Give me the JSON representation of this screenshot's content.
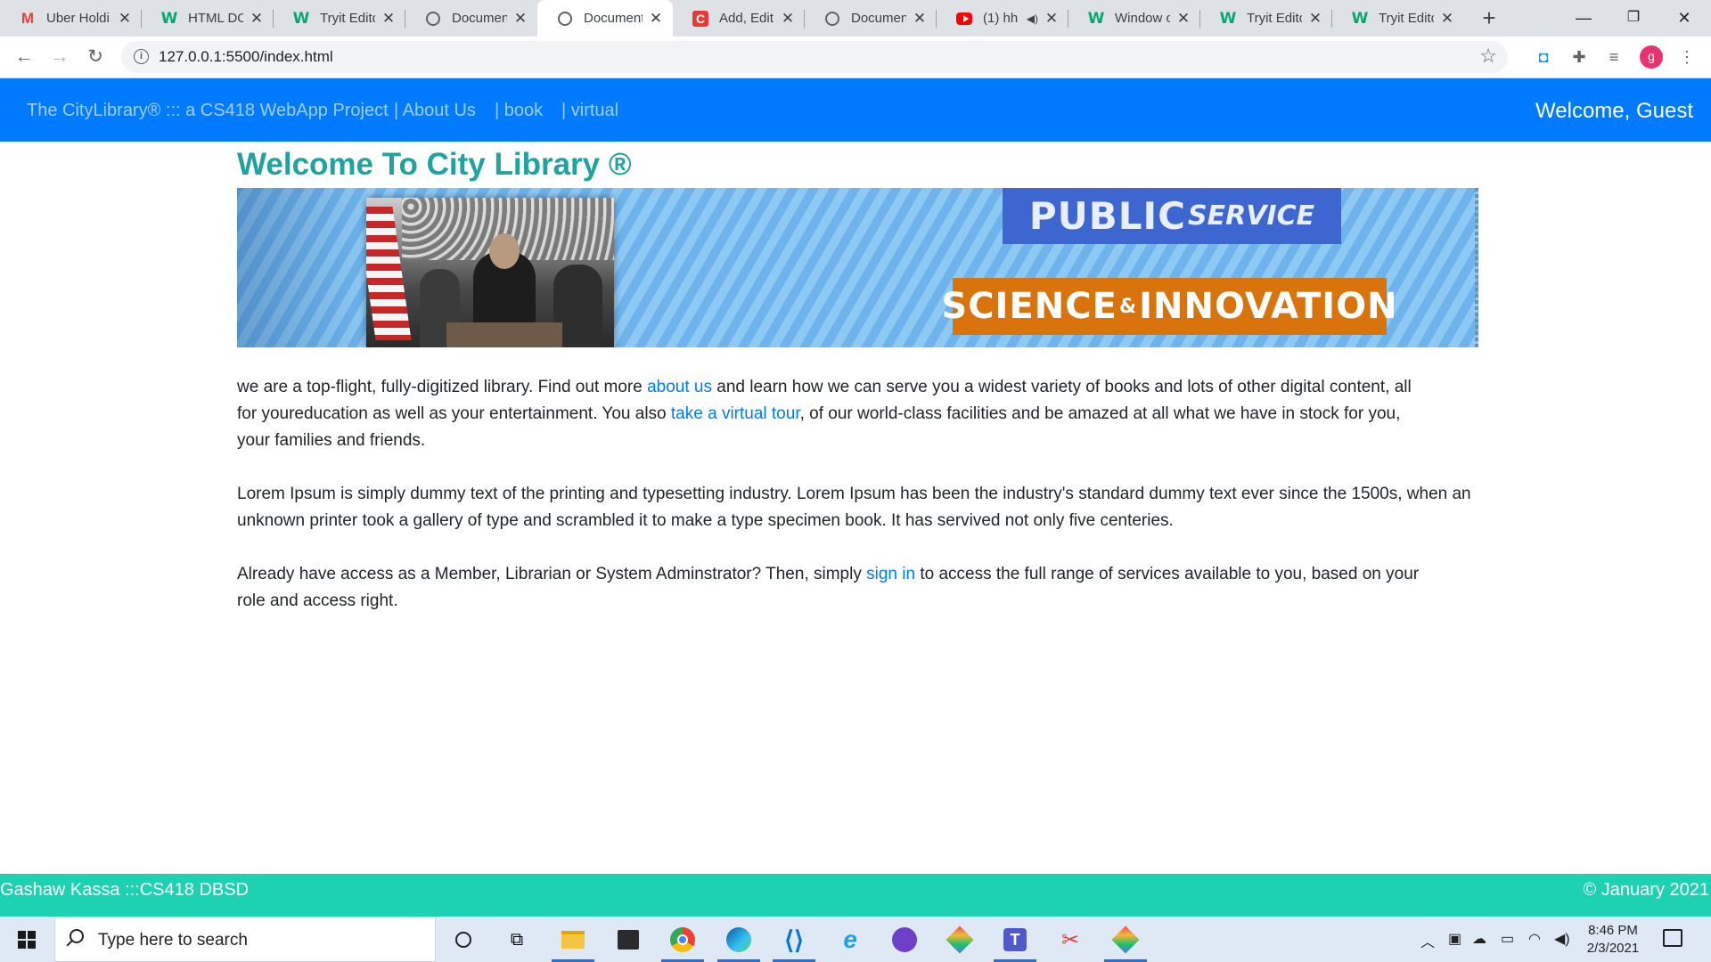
{
  "browser": {
    "tabs": [
      {
        "title": "Uber Holdi",
        "favicon": "gmail-icon",
        "active": false
      },
      {
        "title": "HTML DOI",
        "favicon": "w3schools-icon",
        "active": false
      },
      {
        "title": "Tryit Edito",
        "favicon": "w3schools-icon",
        "active": false
      },
      {
        "title": "Document",
        "favicon": "globe-icon",
        "active": false
      },
      {
        "title": "Document",
        "favicon": "globe-icon",
        "active": true
      },
      {
        "title": "Add, Edit c",
        "favicon": "c-app-icon",
        "active": false
      },
      {
        "title": "Document",
        "favicon": "globe-icon",
        "active": false
      },
      {
        "title": "(1) hh",
        "favicon": "youtube-icon",
        "active": false
      },
      {
        "title": "Window c",
        "favicon": "w3schools-icon",
        "active": false
      },
      {
        "title": "Tryit Edito",
        "favicon": "w3schools-icon",
        "active": false
      },
      {
        "title": "Tryit Edito",
        "favicon": "w3schools-icon",
        "active": false
      }
    ],
    "url": "127.0.0.1:5500/index.html",
    "profile_initial": "g"
  },
  "navbar": {
    "brand": "The CityLibrary® ::: a CS418 WebApp Project",
    "links": [
      "| About Us",
      "| book",
      "| virtual"
    ],
    "welcome": "Welcome, Guest"
  },
  "main": {
    "title": "Welcome To City Library ®",
    "banner": {
      "tag_public_big": "PUBLIC",
      "tag_public_small": "SERVICE",
      "tag_science_a": "SCIENCE",
      "tag_science_amp": "&",
      "tag_science_b": "INNOVATION"
    },
    "p1": {
      "t1": "we are a top-flight, fully-digitized library. Find out more ",
      "link1": "about us",
      "t2": " and learn how we can serve you a widest variety of books and lots of other digital content, all for youreducation as well as your entertainment. You also ",
      "link2": "take a virtual tour",
      "t3": ", of our world-class facilities and be amazed at all what we have in stock for you, your families and friends."
    },
    "p2": "Lorem Ipsum is simply dummy text of the printing and typesetting industry. Lorem Ipsum has been the industry's standard dummy text ever since the 1500s, when an unknown printer took a gallery of type and scrambled it to make a type specimen book. It has servived not only five centeries.",
    "p3": {
      "t1": "Already have access as a Member, Librarian or System Adminstrator? Then, simply ",
      "link": "sign in",
      "t2": " to access the full range of services available to you, based on your role and access right."
    }
  },
  "footer": {
    "left": "Gashaw Kassa :::CS418 DBSD",
    "right": "© January 2021"
  },
  "taskbar": {
    "search_placeholder": "Type here to search",
    "time": "8:46 PM",
    "date": "2/3/2021"
  },
  "colors": {
    "navbar": "#007bff",
    "title": "#20a39e",
    "footer": "#1dd1b1",
    "link": "#007bff"
  }
}
